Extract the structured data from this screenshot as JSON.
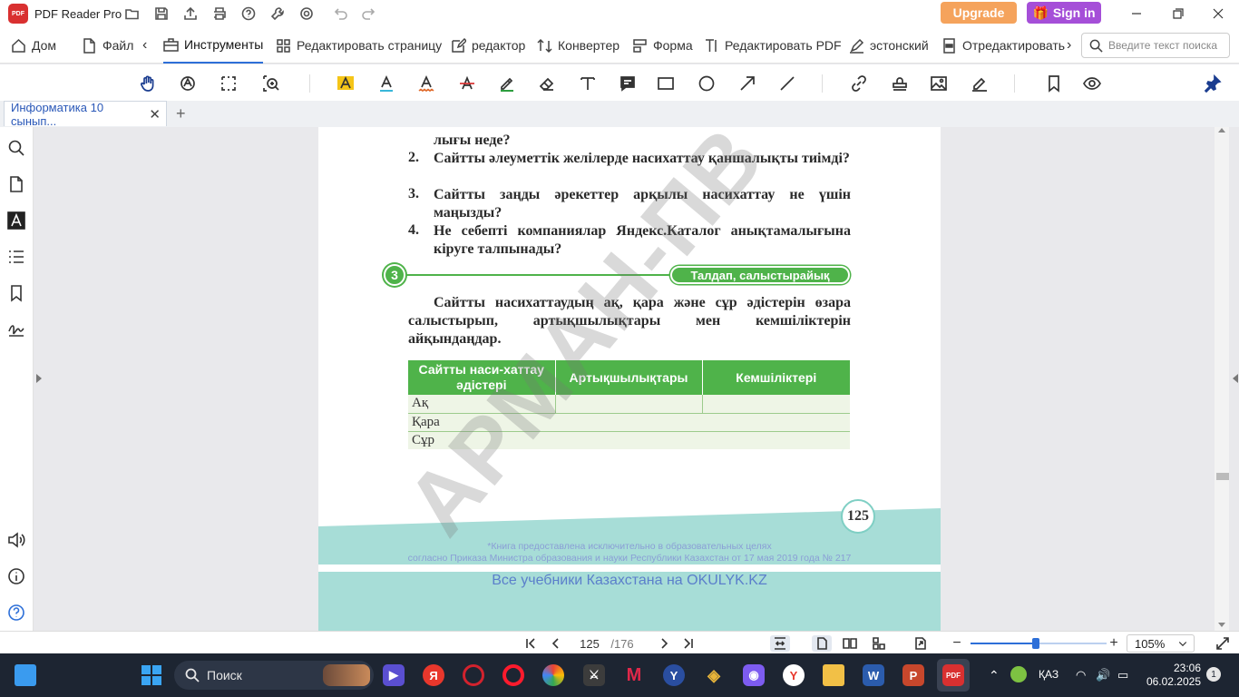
{
  "app": {
    "title": "PDF Reader Pro",
    "logo_text": "PDF",
    "upgrade_label": "Upgrade",
    "signin_label": "Sign in",
    "colors": {
      "upgrade": "#f5a35c",
      "signin": "#a54fd8",
      "accent": "#2d6fd8",
      "green": "#4fb34a",
      "teal": "#a7ddd7"
    }
  },
  "menu": {
    "items": [
      {
        "label": "Дом",
        "icon": "home-icon"
      },
      {
        "label": "Файл",
        "icon": "file-icon"
      },
      {
        "label": "Инструменты",
        "icon": "toolbox-icon",
        "active": true
      },
      {
        "label": "Редактировать страницу",
        "icon": "grid-icon"
      },
      {
        "label": "редактор",
        "icon": "edit-icon"
      },
      {
        "label": "Конвертер",
        "icon": "convert-icon"
      },
      {
        "label": "Форма",
        "icon": "form-icon"
      },
      {
        "label": "Редактировать PDF",
        "icon": "text-edit-icon"
      },
      {
        "label": "эстонский",
        "icon": "sign-icon"
      },
      {
        "label": "Отредактировать",
        "icon": "redact-icon"
      }
    ],
    "search_placeholder": "Введите текст поиска"
  },
  "tab": {
    "label": "Информатика 10  сынып...",
    "close": "✕",
    "add": "+"
  },
  "document": {
    "questions": [
      {
        "num": "",
        "text": "лығы неде?"
      },
      {
        "num": "2.",
        "text": "Сайтты әлеуметтік желілерде насихаттау қаншалықты тиімді?"
      },
      {
        "num": "3.",
        "text": "Сайтты заңды әрекеттер арқылы насихаттау не үшін маңызды?"
      },
      {
        "num": "4.",
        "text": "Не себепті компаниялар Яндекс.Каталог анықтамалығына кіруге талпынады?"
      }
    ],
    "section_number": "3",
    "section_title": "Талдап, салыстырайық",
    "paragraph": "Сайтты насихаттаудың ақ, қара және сұр әдістерін өзара салыстырып, артықшылықтары мен кемшіліктерін айқындаңдар.",
    "table": {
      "headers": [
        "Сайтты наси-хаттау әдістері",
        "Артықшылықтары",
        "Кемшіліктері"
      ],
      "rows": [
        [
          "Ақ",
          "",
          ""
        ],
        [
          "Қара",
          "",
          ""
        ],
        [
          "Сұр",
          "",
          ""
        ]
      ]
    },
    "page_number": "125",
    "notice_line1": "*Книга предоставлена исключительно в образовательных целях",
    "notice_line2": "согласно Приказа Министра образования и науки Республики Казахстан от 17 мая 2019 года № 217",
    "okulyk": "Все учебники Казахстана на OKULYK.KZ",
    "watermark": "АРМАН-ПВ"
  },
  "status": {
    "current_page": "125",
    "total_pages": "/176",
    "zoom": "105%",
    "zoom_level_fraction": 0.48
  },
  "taskbar": {
    "search_label": "Поиск",
    "lang": "ҚАЗ",
    "time": "23:06",
    "date": "06.02.2025",
    "notifications": "1"
  }
}
